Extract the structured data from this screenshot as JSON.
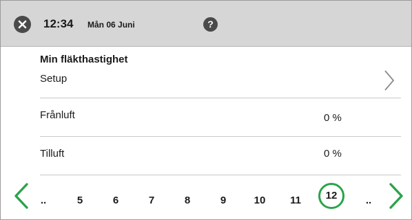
{
  "header": {
    "close_icon": "close-icon",
    "time": "12:34",
    "date": "Mån 06 Juni",
    "help_label": "?"
  },
  "section": {
    "title": "Min fläkthastighet"
  },
  "rows": [
    {
      "label": "Setup",
      "value": "",
      "icon": "chevron-right-icon"
    },
    {
      "label": "Frånluft",
      "value": "0 %"
    },
    {
      "label": "Tilluft",
      "value": "0 %"
    }
  ],
  "pager": {
    "items": [
      "..",
      "5",
      "6",
      "7",
      "8",
      "9",
      "10",
      "11",
      "12",
      ".."
    ],
    "current": "12"
  },
  "colors": {
    "accent": "#2aa34a",
    "header_bg": "#d6d6d6",
    "icon_dark": "#4a4a4a"
  }
}
